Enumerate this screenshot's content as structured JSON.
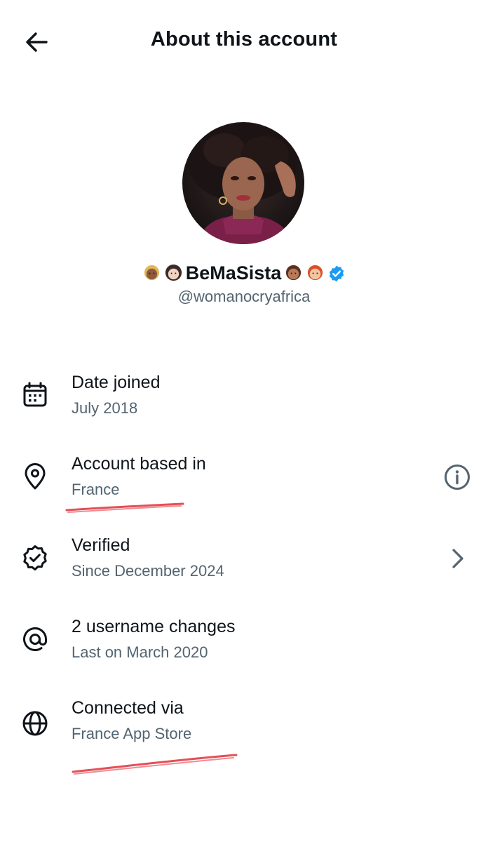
{
  "header": {
    "title": "About this account",
    "back_icon": "arrow-left-icon"
  },
  "profile": {
    "display_name": "BeMaSista",
    "handle": "@womanocryafrica",
    "verified_badge_color": "#1d9bf0"
  },
  "rows": [
    {
      "title": "Date joined",
      "subtitle": "July 2018",
      "icon": "calendar-icon"
    },
    {
      "title": "Account based in",
      "subtitle": "France",
      "icon": "location-pin-icon",
      "right_icon": "info-icon"
    },
    {
      "title": "Verified",
      "subtitle": "Since December 2024",
      "icon": "verified-badge-icon",
      "right_icon": "chevron-right-icon"
    },
    {
      "title": "2 username changes",
      "subtitle": "Last on March 2020",
      "icon": "at-sign-icon"
    },
    {
      "title": "Connected via",
      "subtitle": "France App Store",
      "icon": "globe-icon"
    }
  ],
  "colors": {
    "text_primary": "#0f1419",
    "text_secondary": "#536471",
    "annotation_red": "#e0303a"
  }
}
